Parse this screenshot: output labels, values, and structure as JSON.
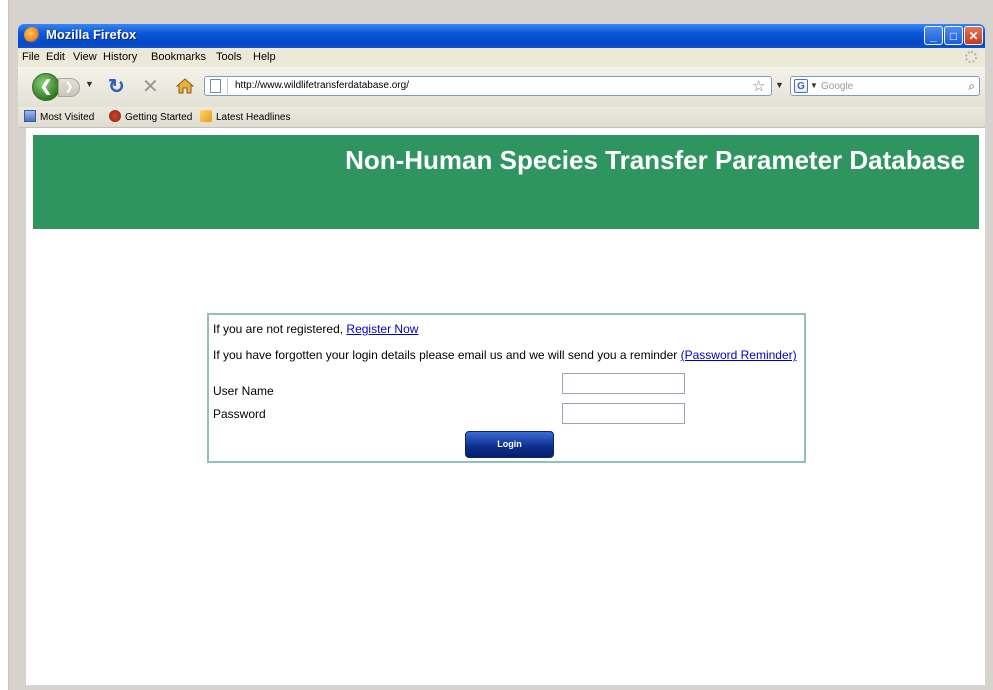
{
  "window": {
    "title": "Mozilla Firefox"
  },
  "menu": [
    "File",
    "Edit",
    "View",
    "History",
    "Bookmarks",
    "Tools",
    "Help"
  ],
  "navbar": {
    "url": "http://www.wildlifetransferdatabase.org/",
    "search_placeholder": "Google"
  },
  "bookmarks": [
    "Most Visited",
    "Getting Started",
    "Latest Headlines"
  ],
  "page": {
    "banner_title": "Non-Human Species Transfer Parameter Database",
    "not_registered_text": "If you are not registered, ",
    "register_link": "Register Now",
    "forgot_text": "If you have forgotten your login details please email us and we will send you a reminder ",
    "password_reminder_link": "(Password Reminder)",
    "user_name_label": "User Name",
    "password_label": "Password",
    "login_button": "Login"
  },
  "colors": {
    "banner": "#2e9460",
    "titlebar": "#0a57d6",
    "login_button": "#0b2d8c",
    "link": "#0000cc"
  }
}
